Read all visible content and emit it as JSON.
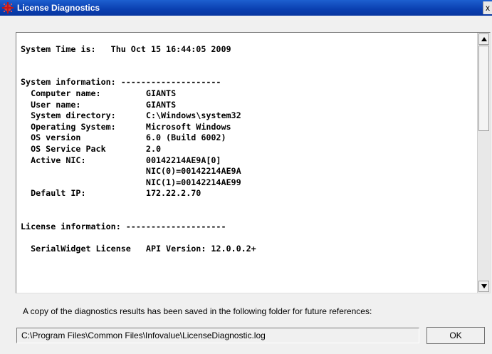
{
  "window": {
    "title": "License Diagnostics",
    "title_color": "#0a3fb0",
    "close_label": "x"
  },
  "log": {
    "lines": [
      "",
      "System Time is:   Thu Oct 15 16:44:05 2009",
      "",
      "",
      "System information: --------------------",
      "  Computer name:         GIANTS",
      "  User name:             GIANTS",
      "  System directory:      C:\\Windows\\system32",
      "  Operating System:      Microsoft Windows",
      "  OS version             6.0 (Build 6002)",
      "  OS Service Pack        2.0",
      "  Active NIC:            00142214AE9A[0]",
      "                         NIC(0)=00142214AE9A",
      "                         NIC(1)=00142214AE99",
      "  Default IP:            172.22.2.70",
      "",
      "",
      "License information: --------------------",
      "",
      "  SerialWidget License   API Version: 12.0.0.2+"
    ]
  },
  "scrollbar": {
    "up_icon": "arrow-up-icon",
    "down_icon": "arrow-down-icon"
  },
  "footer": {
    "hint": "A copy of the diagnostics results has been saved in the following folder for future references:",
    "path": "C:\\Program Files\\Common Files\\Infovalue\\LicenseDiagnostic.log",
    "ok_label": "OK"
  }
}
